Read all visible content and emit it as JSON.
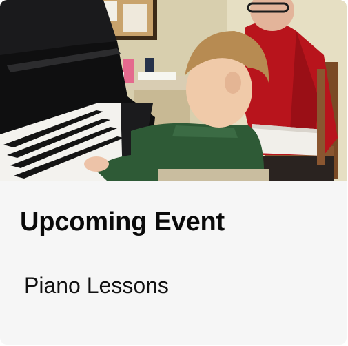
{
  "event_card": {
    "image": {
      "subject": "child-playing-piano-with-teacher"
    },
    "heading": "Upcoming Event",
    "event_name": "Piano Lessons"
  },
  "colors": {
    "card_background": "#f6f6f6",
    "heading_text": "#0a0a0a",
    "subtitle_text": "#111111"
  }
}
